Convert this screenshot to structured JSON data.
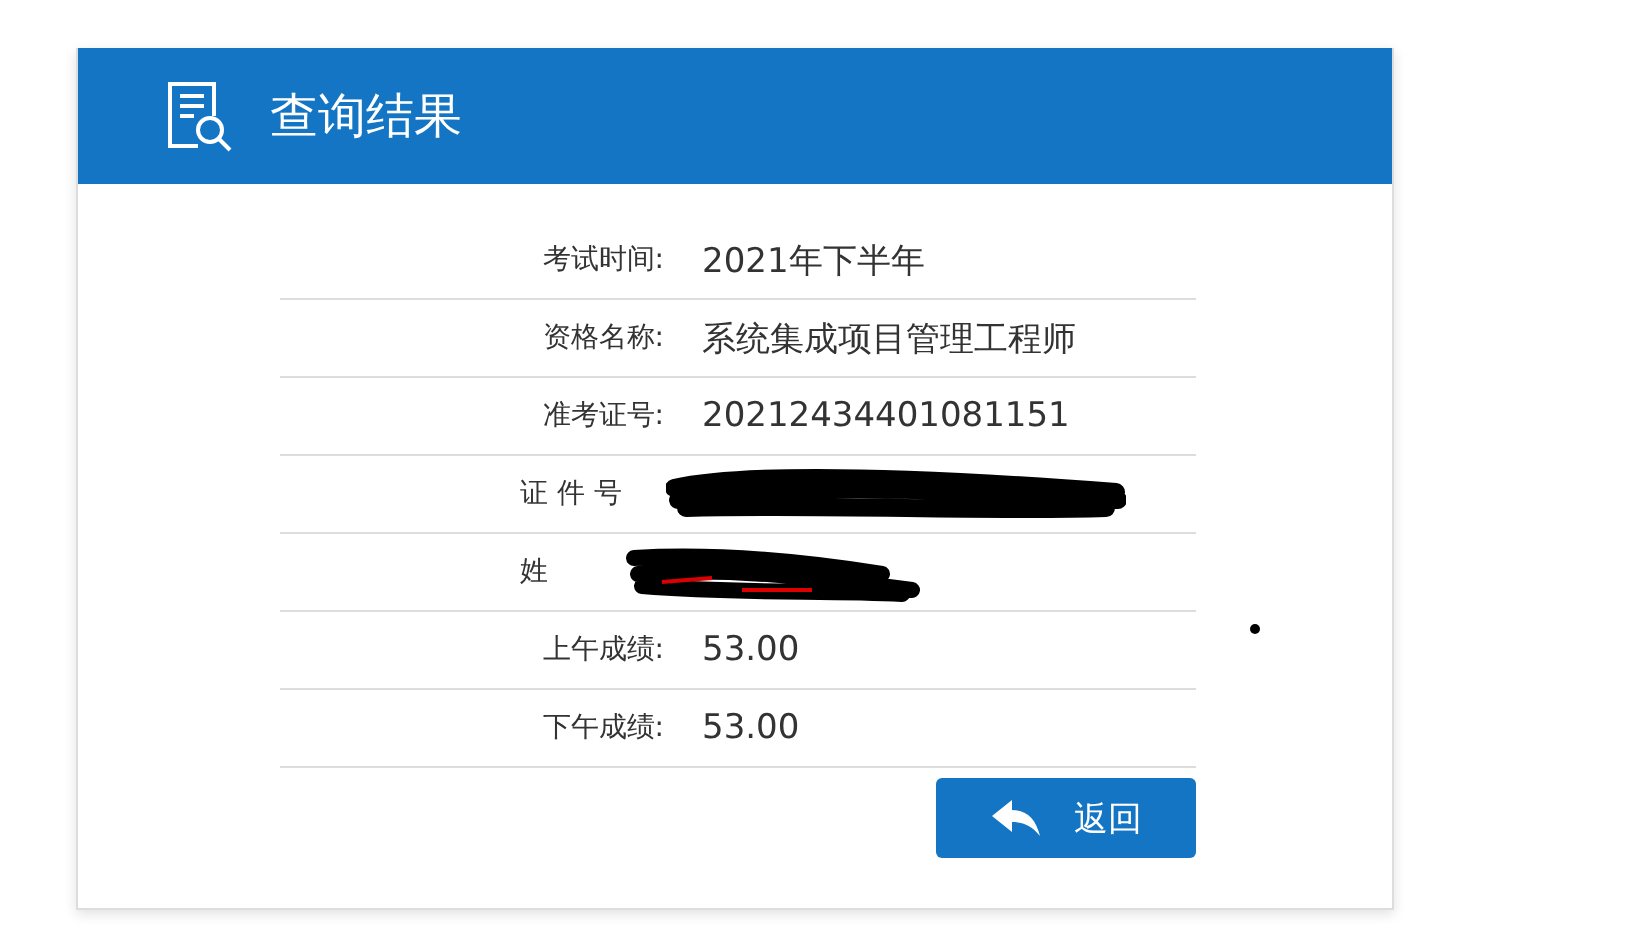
{
  "header": {
    "title": "查询结果"
  },
  "rows": [
    {
      "kind": "text",
      "label": "考试时间:",
      "value": "2021年下半年"
    },
    {
      "kind": "text",
      "label": "资格名称:",
      "value": "系统集成项目管理工程师"
    },
    {
      "kind": "text",
      "label": "准考证号:",
      "value": "20212434401081151"
    },
    {
      "kind": "redacted",
      "label": "证 件 号"
    },
    {
      "kind": "redacted",
      "label": "姓"
    },
    {
      "kind": "text",
      "label": "上午成绩:",
      "value": "53.00"
    },
    {
      "kind": "text",
      "label": "下午成绩:",
      "value": "53.00"
    }
  ],
  "back_button": {
    "label": "返回"
  }
}
